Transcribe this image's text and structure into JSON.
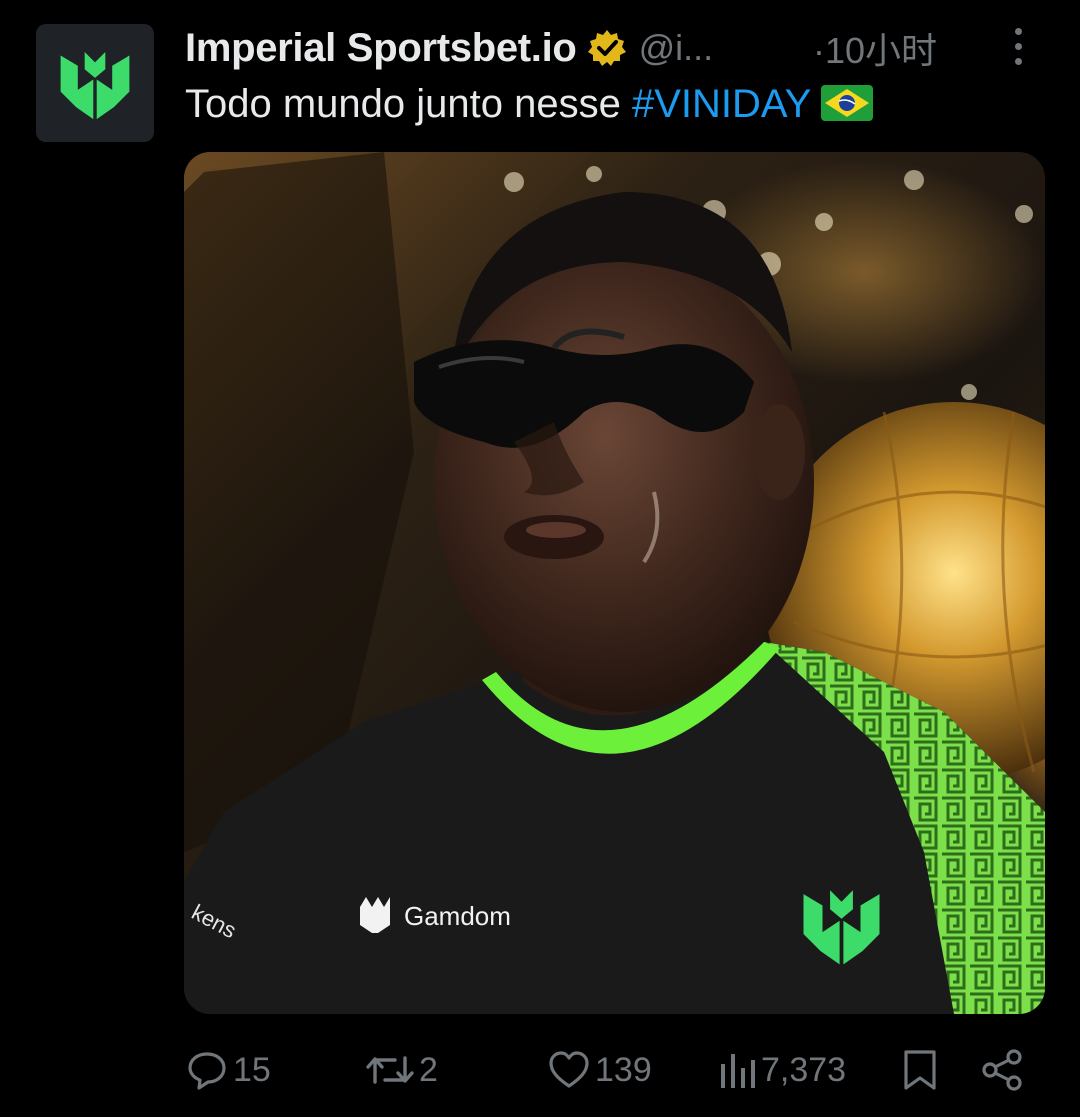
{
  "author": {
    "display_name": "Imperial Sportsbet.io",
    "handle": "@i...",
    "timestamp": "·10小时",
    "verified": true,
    "avatar_icon": "imperial-logo-icon"
  },
  "tweet": {
    "text": "Todo mundo junto nesse ",
    "hashtag": "#VINIDAY",
    "emoji": "brazil-flag-icon"
  },
  "media": {
    "jersey_sponsor": "Gamdom",
    "sleeve_text": "kens"
  },
  "actions": {
    "replies": "15",
    "retweets": "2",
    "likes": "139",
    "views": "7,373"
  },
  "colors": {
    "background": "#000000",
    "text": "#e7e9ea",
    "secondary": "#71767b",
    "link": "#1d9bf0",
    "brand_green": "#3ddc6a",
    "verified_gold": "#e2b719"
  }
}
